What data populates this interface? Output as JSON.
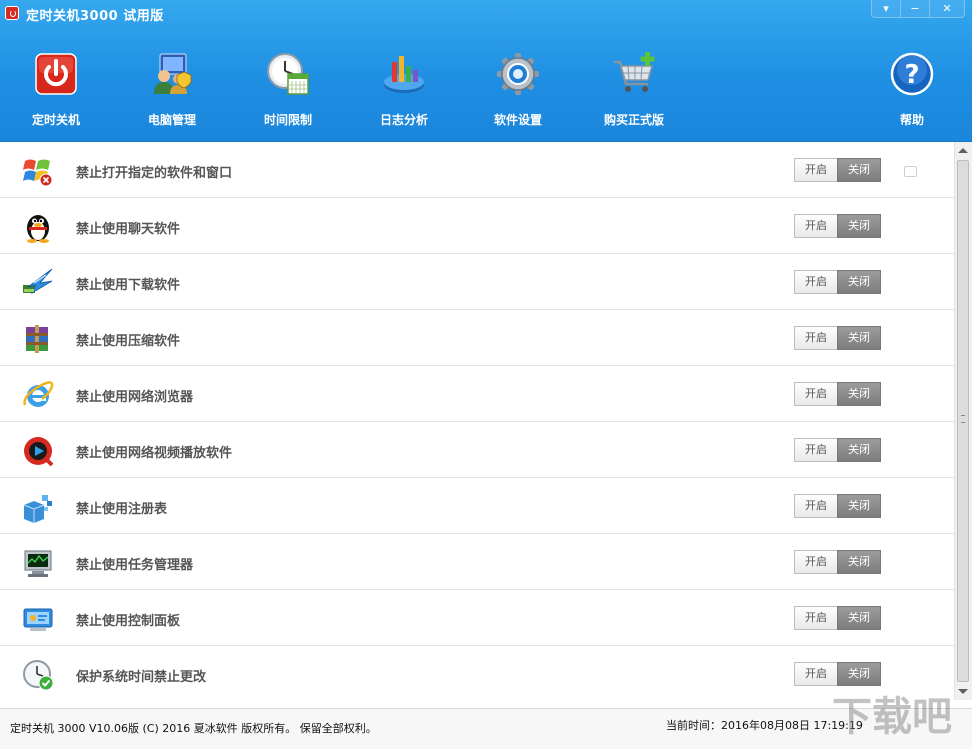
{
  "window": {
    "title": "定时关机3000 试用版",
    "controls": [
      "▾",
      "−",
      "✕"
    ]
  },
  "toolbar": [
    {
      "label": "定时关机",
      "icon": "power-icon"
    },
    {
      "label": "电脑管理",
      "icon": "computer-admin-icon"
    },
    {
      "label": "时间限制",
      "icon": "clock-calendar-icon"
    },
    {
      "label": "日志分析",
      "icon": "chart-analysis-icon"
    },
    {
      "label": "软件设置",
      "icon": "gear-icon"
    },
    {
      "label": "购买正式版",
      "icon": "shopping-cart-icon"
    },
    {
      "label": "帮助",
      "icon": "help-icon"
    }
  ],
  "rows": [
    {
      "label": "禁止打开指定的软件和窗口",
      "icon": "windows-forbid-icon",
      "on": "开启",
      "off": "关闭"
    },
    {
      "label": "禁止使用聊天软件",
      "icon": "qq-penguin-icon",
      "on": "开启",
      "off": "关闭"
    },
    {
      "label": "禁止使用下载软件",
      "icon": "download-bird-icon",
      "on": "开启",
      "off": "关闭"
    },
    {
      "label": "禁止使用压缩软件",
      "icon": "winrar-icon",
      "on": "开启",
      "off": "关闭"
    },
    {
      "label": "禁止使用网络浏览器",
      "icon": "ie-browser-icon",
      "on": "开启",
      "off": "关闭"
    },
    {
      "label": "禁止使用网络视频播放软件",
      "icon": "video-player-icon",
      "on": "开启",
      "off": "关闭"
    },
    {
      "label": "禁止使用注册表",
      "icon": "registry-cubes-icon",
      "on": "开启",
      "off": "关闭"
    },
    {
      "label": "禁止使用任务管理器",
      "icon": "task-manager-icon",
      "on": "开启",
      "off": "关闭"
    },
    {
      "label": "禁止使用控制面板",
      "icon": "control-panel-icon",
      "on": "开启",
      "off": "关闭"
    },
    {
      "label": "保护系统时间禁止更改",
      "icon": "clock-shield-icon",
      "on": "开启",
      "off": "关闭"
    }
  ],
  "footer": {
    "copyright": "定时关机 3000 V10.06版 (C) 2016 夏冰软件 版权所有。 保留全部权利。",
    "time": "当前时间：2016年08月08日 17:19:19"
  },
  "watermark": "下载吧",
  "colors": {
    "header": "#1f8fe3",
    "toggle_off": "#8a8a8a"
  }
}
